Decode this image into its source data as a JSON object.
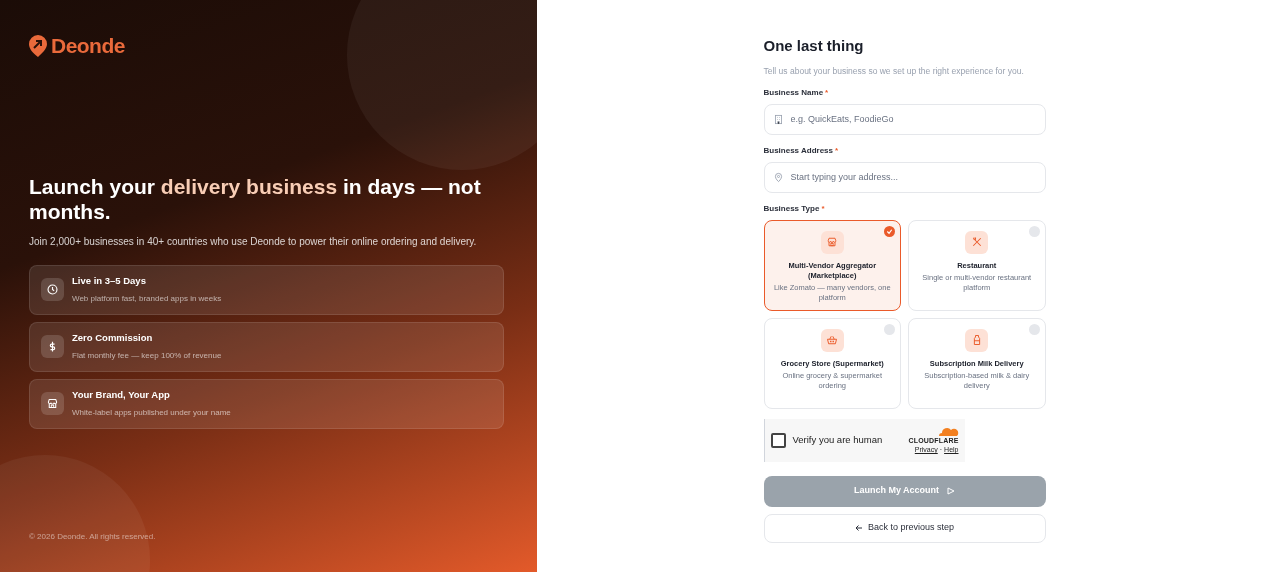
{
  "brand": {
    "name": "Deonde"
  },
  "hero": {
    "headline": [
      {
        "text": "Launch your ",
        "highlight": false
      },
      {
        "text": "delivery business",
        "highlight": true
      },
      {
        "text": " in days — not months.",
        "highlight": false
      }
    ],
    "subtitle": "Join 2,000+ businesses in 40+ countries who use Deonde to power their online ordering and delivery."
  },
  "features": [
    {
      "kind": "clock",
      "title": "Live in 3–5 Days",
      "description": "Web platform fast, branded apps in weeks"
    },
    {
      "kind": "dollar",
      "title": "Zero Commission",
      "description": "Flat monthly fee — keep 100% of revenue"
    },
    {
      "kind": "store",
      "title": "Your Brand, Your App",
      "description": "White-label apps published under your name"
    }
  ],
  "footer": "© 2026 Deonde. All rights reserved.",
  "form": {
    "title": "One last thing",
    "subtitle": "Tell us about your business so we set up the right experience for you.",
    "fields": [
      {
        "kind": "building",
        "label": "Business Name",
        "required_mark": "*",
        "placeholder": "e.g. QuickEats, FoodieGo"
      },
      {
        "kind": "pin",
        "label": "Business Address",
        "required_mark": "*",
        "placeholder": "Start typing your address..."
      }
    ],
    "type_label": "Business Type",
    "type_required_mark": "*",
    "types": [
      {
        "kind": "store",
        "title": "Multi-Vendor Aggregator (Marketplace)",
        "description": "Like Zomato — many vendors, one platform",
        "selected": true
      },
      {
        "kind": "utensils",
        "title": "Restaurant",
        "description": "Single or multi-vendor restaurant platform",
        "selected": false
      },
      {
        "kind": "basket",
        "title": "Grocery Store (Supermarket)",
        "description": "Online grocery & supermarket ordering",
        "selected": false
      },
      {
        "kind": "bottle",
        "title": "Subscription Milk Delivery",
        "description": "Subscription-based milk & dairy delivery",
        "selected": false
      }
    ],
    "captcha": {
      "label": "Verify you are human",
      "checked": false,
      "provider": "CLOUDFLARE",
      "links": [
        "Privacy",
        "Help"
      ],
      "link_separator": "·"
    },
    "submit": {
      "label": "Launch My Account",
      "disabled": true
    },
    "back": {
      "label": "Back to previous step"
    }
  }
}
